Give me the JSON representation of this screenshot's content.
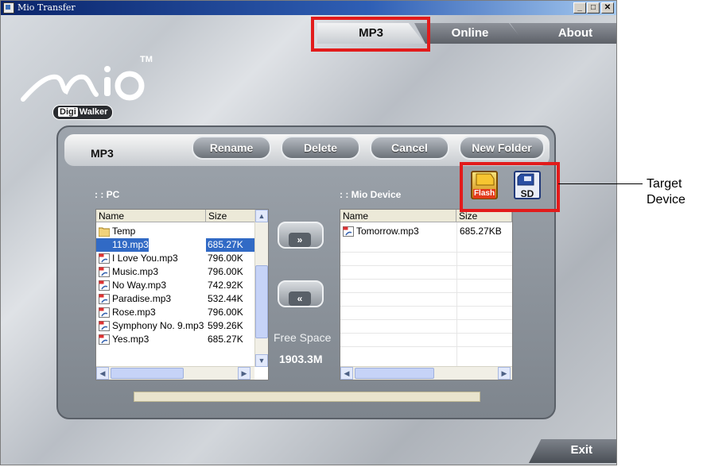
{
  "window": {
    "title": "Mio Transfer",
    "controls": {
      "minimize": "_",
      "maximize": "□",
      "close": "✕"
    }
  },
  "tabs": [
    {
      "label": "MP3",
      "active": true
    },
    {
      "label": "Online",
      "active": false
    },
    {
      "label": "About",
      "active": false
    }
  ],
  "logo": {
    "brand": "Mio",
    "tm": "TM",
    "sub_digi": "Digi",
    "sub_walker": "Walker"
  },
  "section": {
    "title": "MP3"
  },
  "actions": {
    "rename": "Rename",
    "delete": "Delete",
    "cancel": "Cancel",
    "new_folder": "New Folder"
  },
  "pc": {
    "label": ": : PC",
    "columns": {
      "name": "Name",
      "size": "Size"
    },
    "files": [
      {
        "name": "Temp",
        "size": "",
        "type": "folder"
      },
      {
        "name": "119.mp3",
        "size": "685.27K",
        "type": "mp3",
        "selected": true
      },
      {
        "name": "I Love You.mp3",
        "size": "796.00K",
        "type": "mp3"
      },
      {
        "name": "Music.mp3",
        "size": "796.00K",
        "type": "mp3"
      },
      {
        "name": "No Way.mp3",
        "size": "742.92K",
        "type": "mp3"
      },
      {
        "name": "Paradise.mp3",
        "size": "532.44K",
        "type": "mp3"
      },
      {
        "name": "Rose.mp3",
        "size": "796.00K",
        "type": "mp3"
      },
      {
        "name": "Symphony No. 9.mp3",
        "size": "599.26K",
        "type": "mp3"
      },
      {
        "name": "Yes.mp3",
        "size": "685.27K",
        "type": "mp3"
      }
    ]
  },
  "device": {
    "label": ": : Mio Device",
    "columns": {
      "name": "Name",
      "size": "Size"
    },
    "files": [
      {
        "name": "Tomorrow.mp3",
        "size": "685.27KB",
        "type": "mp3"
      }
    ],
    "targets": [
      {
        "label": "Flash"
      },
      {
        "label": "SD"
      }
    ]
  },
  "transfer": {
    "to_device": "»",
    "to_pc": "«"
  },
  "storage": {
    "free_space_label": "Free Space",
    "free_space_value": "1903.3M"
  },
  "progress": 0,
  "exit_label": "Exit",
  "annotation": {
    "line1": "Target",
    "line2": "Device"
  },
  "colors": {
    "highlight_red": "#e21b1b",
    "selection_blue": "#316ac5"
  }
}
